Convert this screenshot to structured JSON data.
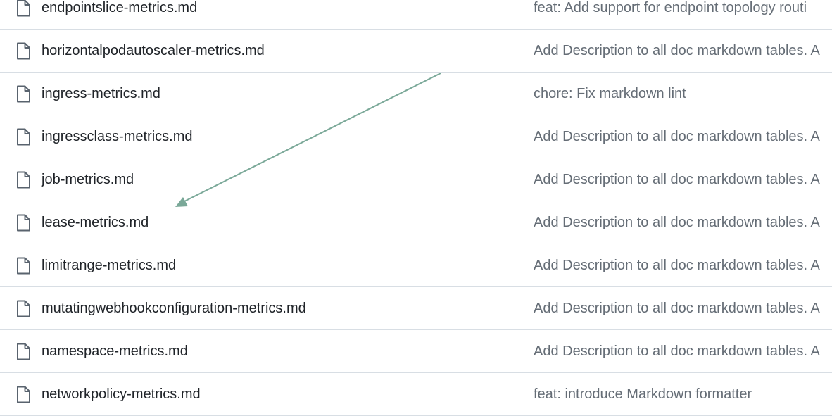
{
  "files": [
    {
      "name": "endpointslice-metrics.md",
      "commit": "feat: Add support for endpoint topology routi",
      "icon": "file-icon"
    },
    {
      "name": "horizontalpodautoscaler-metrics.md",
      "commit": "Add Description to all doc markdown tables. A",
      "icon": "file-icon"
    },
    {
      "name": "ingress-metrics.md",
      "commit": "chore: Fix markdown lint",
      "icon": "file-icon"
    },
    {
      "name": "ingressclass-metrics.md",
      "commit": "Add Description to all doc markdown tables. A",
      "icon": "file-icon"
    },
    {
      "name": "job-metrics.md",
      "commit": "Add Description to all doc markdown tables. A",
      "icon": "file-icon"
    },
    {
      "name": "lease-metrics.md",
      "commit": "Add Description to all doc markdown tables. A",
      "icon": "file-icon"
    },
    {
      "name": "limitrange-metrics.md",
      "commit": "Add Description to all doc markdown tables. A",
      "icon": "file-icon"
    },
    {
      "name": "mutatingwebhookconfiguration-metrics.md",
      "commit": "Add Description to all doc markdown tables. A",
      "icon": "file-icon"
    },
    {
      "name": "namespace-metrics.md",
      "commit": "Add Description to all doc markdown tables. A",
      "icon": "file-icon"
    },
    {
      "name": "networkpolicy-metrics.md",
      "commit": "feat: introduce Markdown formatter",
      "icon": "file-icon"
    }
  ],
  "colors": {
    "file_name": "#1f2328",
    "commit_message": "#656d76",
    "icon_stroke": "#59636e",
    "row_border": "#d8dee4",
    "annotation_arrow": "#7aa898"
  }
}
